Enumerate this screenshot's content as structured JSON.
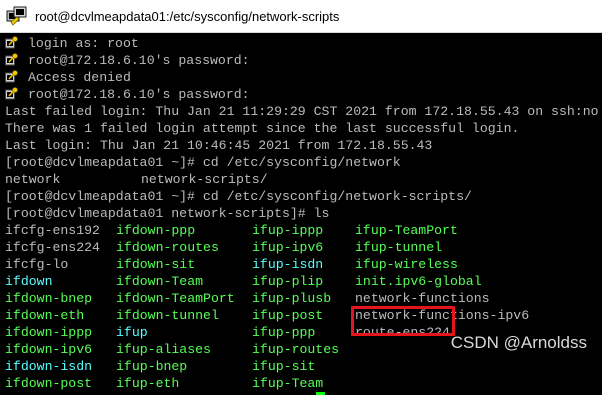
{
  "window": {
    "title": "root@dcvlmeapdata01:/etc/sysconfig/network-scripts",
    "icon": "putty-terminal-icon"
  },
  "terminal": {
    "colors": {
      "background": "#000000",
      "text": "#bbbbbb",
      "green": "#55ff55",
      "cyan": "#55ffff",
      "blue": "#5555ff",
      "cursor": "#00ff00",
      "highlight_border": "#e8141b"
    },
    "auth_lines": [
      "login as: root",
      "root@172.18.6.10's password:",
      "Access denied",
      "root@172.18.6.10's password:"
    ],
    "session_lines": [
      "Last failed login: Thu Jan 21 11:29:29 CST 2021 from 172.18.55.43 on ssh:no",
      "There was 1 failed login attempt since the last successful login.",
      "Last login: Thu Jan 21 10:46:45 2021 from 172.18.55.43",
      "[root@dcvlmeapdata01 ~]# cd /etc/sysconfig/network"
    ],
    "completion_line": {
      "col1": "network",
      "col2": "network-scripts/"
    },
    "cd_line": "[root@dcvlmeapdata01 ~]# cd /etc/sysconfig/network-scripts/",
    "ls_line": "[root@dcvlmeapdata01 network-scripts]# ls",
    "ls_rows": [
      [
        {
          "t": "ifcfg-ens192",
          "c": "white"
        },
        {
          "t": "ifdown-ppp",
          "c": "green"
        },
        {
          "t": "ifup-ippp",
          "c": "green"
        },
        {
          "t": "ifup-TeamPort",
          "c": "green"
        }
      ],
      [
        {
          "t": "ifcfg-ens224",
          "c": "white"
        },
        {
          "t": "ifdown-routes",
          "c": "green"
        },
        {
          "t": "ifup-ipv6",
          "c": "green"
        },
        {
          "t": "ifup-tunnel",
          "c": "green"
        }
      ],
      [
        {
          "t": "ifcfg-lo",
          "c": "white"
        },
        {
          "t": "ifdown-sit",
          "c": "green"
        },
        {
          "t": "ifup-isdn",
          "c": "cyan"
        },
        {
          "t": "ifup-wireless",
          "c": "green"
        }
      ],
      [
        {
          "t": "ifdown",
          "c": "cyan"
        },
        {
          "t": "ifdown-Team",
          "c": "green"
        },
        {
          "t": "ifup-plip",
          "c": "green"
        },
        {
          "t": "init.ipv6-global",
          "c": "green"
        }
      ],
      [
        {
          "t": "ifdown-bnep",
          "c": "green"
        },
        {
          "t": "ifdown-TeamPort",
          "c": "green"
        },
        {
          "t": "ifup-plusb",
          "c": "green"
        },
        {
          "t": "network-functions",
          "c": "white"
        }
      ],
      [
        {
          "t": "ifdown-eth",
          "c": "green"
        },
        {
          "t": "ifdown-tunnel",
          "c": "green"
        },
        {
          "t": "ifup-post",
          "c": "green"
        },
        {
          "t": "network-functions-ipv6",
          "c": "white"
        }
      ],
      [
        {
          "t": "ifdown-ippp",
          "c": "green"
        },
        {
          "t": "ifup",
          "c": "cyan"
        },
        {
          "t": "ifup-ppp",
          "c": "green"
        },
        {
          "t": "route-ens224",
          "c": "white"
        }
      ],
      [
        {
          "t": "ifdown-ipv6",
          "c": "green"
        },
        {
          "t": "ifup-aliases",
          "c": "green"
        },
        {
          "t": "ifup-routes",
          "c": "green"
        },
        {
          "t": "",
          "c": "white"
        }
      ],
      [
        {
          "t": "ifdown-isdn",
          "c": "cyan"
        },
        {
          "t": "ifup-bnep",
          "c": "green"
        },
        {
          "t": "ifup-sit",
          "c": "green"
        },
        {
          "t": "",
          "c": "white"
        }
      ],
      [
        {
          "t": "ifdown-post",
          "c": "green"
        },
        {
          "t": "ifup-eth",
          "c": "green"
        },
        {
          "t": "ifup-Team",
          "c": "green"
        },
        {
          "t": "",
          "c": "white"
        }
      ]
    ],
    "prompt_line": "[root@dcvlmeapdata01 network-scripts]# "
  },
  "watermark": "CSDN @Arnoldss"
}
